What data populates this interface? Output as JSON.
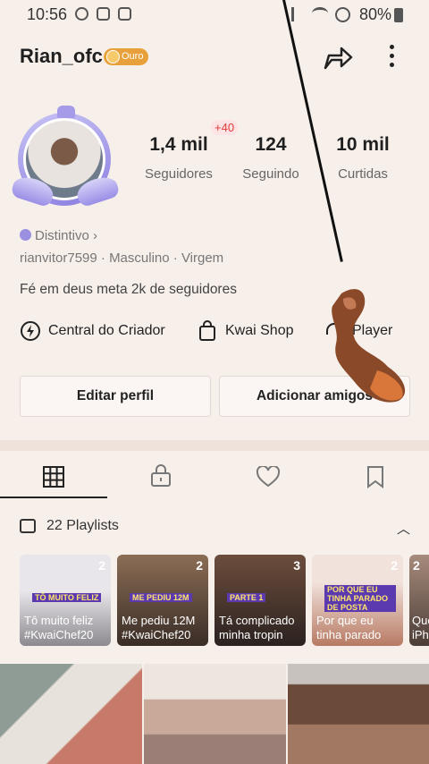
{
  "status_bar": {
    "time": "10:56",
    "battery": "80%"
  },
  "profile": {
    "username": "Rian_ofc",
    "badge": "Ouro",
    "distintivo": "Distintivo",
    "handle": "rianvitor7599",
    "gender": "Masculino",
    "sign": "Virgem",
    "bio": "Fé em deus meta 2k de seguidores"
  },
  "stats": [
    {
      "value": "1,4 mil",
      "label": "Seguidores"
    },
    {
      "value": "124",
      "label": "Seguindo"
    },
    {
      "value": "10 mil",
      "label": "Curtidas"
    }
  ],
  "new_followers_badge": "+40",
  "shortcuts": [
    {
      "label": "Central do Criador",
      "icon": "lightning-icon"
    },
    {
      "label": "Kwai Shop",
      "icon": "shopping-bag-icon"
    },
    {
      "label": "Player",
      "icon": "headphones-icon"
    }
  ],
  "buttons": {
    "edit_profile": "Editar perfil",
    "add_friends": "Adicionar amigos"
  },
  "tabs": [
    "grid-icon",
    "lock-icon",
    "heart-icon",
    "bookmark-icon"
  ],
  "playlists": {
    "header": "22 Playlists",
    "items": [
      {
        "count": "2",
        "tag": "TÔ MUITO FELIZ",
        "line1": "Tô muito feliz",
        "line2": "#KwaiChef20"
      },
      {
        "count": "2",
        "tag": "ME PEDIU 12M",
        "line1": "Me pediu 12M",
        "line2": "#KwaiChef20"
      },
      {
        "count": "3",
        "tag": "PARTE 1",
        "line1": "Tá complicado",
        "line2": "minha tropin"
      },
      {
        "count": "2",
        "tag": "POR QUE EU TINHA PARADO DE POSTA",
        "line1": "Por que eu",
        "line2": "tinha parado"
      },
      {
        "count": "2",
        "tag": "",
        "line1": "Que",
        "line2": "iPh"
      }
    ]
  },
  "colors": {
    "badge_gold": "#e8a13a",
    "accent_red": "#e03b3b",
    "background": "#f7efea"
  }
}
